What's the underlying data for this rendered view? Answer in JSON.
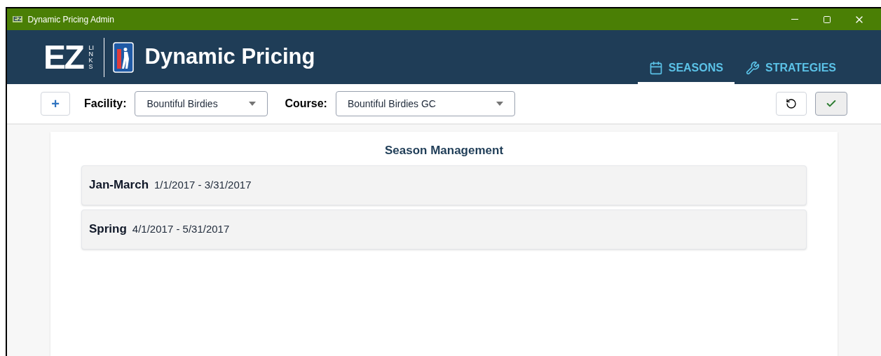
{
  "window": {
    "icon_text": "EZ",
    "title": "Dynamic Pricing Admin"
  },
  "header": {
    "logo_text": "EZ",
    "logo_subtext": "LINKS",
    "title": "Dynamic Pricing",
    "tabs": [
      {
        "kind": "calendar",
        "label": "SEASONS",
        "selected": true
      },
      {
        "kind": "wrench",
        "label": "STRATEGIES",
        "selected": false
      }
    ]
  },
  "toolbar": {
    "add_label": "+",
    "facility": {
      "label": "Facility:",
      "value": "Bountiful Birdies"
    },
    "course": {
      "label": "Course:",
      "value": "Bountiful Birdies GC"
    }
  },
  "content": {
    "title": "Season Management",
    "seasons": [
      {
        "name": "Jan-March",
        "dates": "1/1/2017 - 3/31/2017"
      },
      {
        "name": "Spring",
        "dates": "4/1/2017 - 5/31/2017"
      }
    ]
  }
}
